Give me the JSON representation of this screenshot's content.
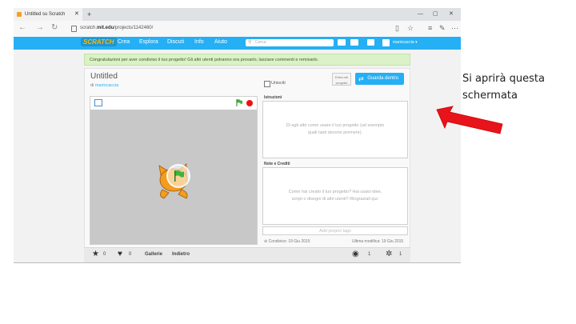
{
  "browser": {
    "tab_title": "Untitled su Scratch",
    "tab_close": "✕",
    "new_tab": "+",
    "url_prefix": "scratch.",
    "url_domain": "mit.edu",
    "url_path": "/projects/1142460/",
    "window_min": "—",
    "window_max": "▢",
    "window_close": "✕"
  },
  "scratch_nav": {
    "logo": "SCRATCH",
    "items": [
      "Crea",
      "Esplora",
      "Discuti",
      "Info",
      "Aiuto"
    ],
    "search_placeholder": "Cerca",
    "username": "mariocaccia ▾"
  },
  "banner": {
    "text": "Congratulazioni per aver condiviso il tuo progetto! Gli altri utenti potranno ora provarlo, lasciare commenti e remixarlo."
  },
  "project": {
    "title": "Untitled",
    "by_prefix": "di",
    "author": "mariocaccia",
    "share_label": "Unisciti",
    "see_inside": "Entra nel progetto",
    "save_button": "Guarda dentro",
    "instructions_label": "Istruzioni",
    "instructions_placeholder": "Di agli altri come usare il tuo progetto (ad esempio quali tasti devono premere).",
    "notes_label": "Note e Crediti",
    "notes_placeholder": "Come hai creato il tuo progetto? Hai usato idee, script o disegni di altri utenti? Ringraziali qui.",
    "tags_placeholder": "Add project tags",
    "shared_date": "Condiviso: 19 Giu 2015",
    "modified_date": "Ultima modifica: 19 Giu 2015"
  },
  "stats": {
    "loves": "0",
    "favorites": "0",
    "studios_link": "Gallerie",
    "remix_link": "Indietro",
    "views": "1",
    "remixes": "1"
  },
  "annotation": {
    "line1": "Si aprirà questa",
    "line2": "schermata"
  },
  "colors": {
    "scratch_blue": "#25aff4",
    "banner_green": "#dbf1c7",
    "arrow_red": "#e8141b"
  }
}
